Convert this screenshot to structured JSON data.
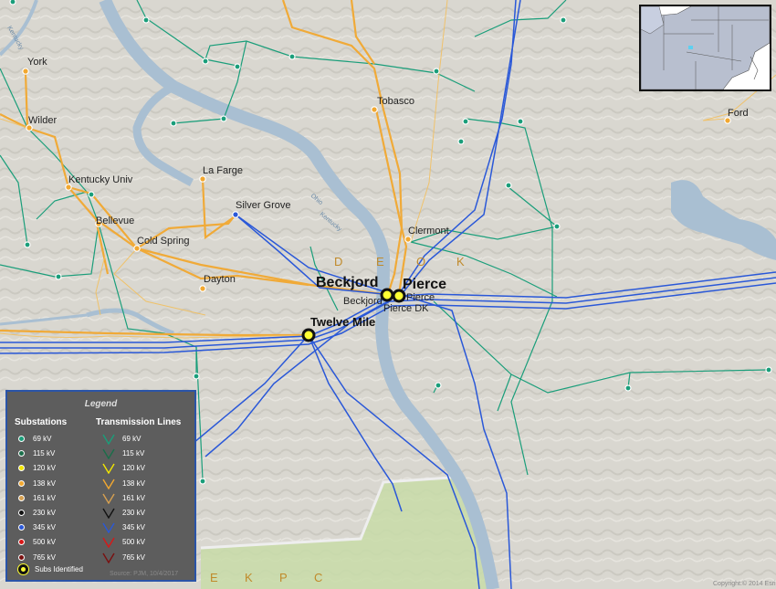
{
  "places": {
    "york": "York",
    "wilder": "Wilder",
    "tobasco": "Tobasco",
    "ford": "Ford",
    "kentucky_univ": "Kentucky Univ",
    "la_farge": "La Farge",
    "silver_grove": "Silver Grove",
    "bellevue": "Bellevue",
    "cold_spring": "Cold Spring",
    "clermont": "Clermont",
    "dayton": "Dayton",
    "beckjord_major": "Beckjord",
    "pierce_major": "Pierce",
    "beckjord_minor": "Beckjord",
    "pierce_minor": "Pierce",
    "pierce_dk": "Pierce DK",
    "twelve_mile": "Twelve Mile"
  },
  "zones": {
    "deok": [
      "D",
      "E",
      "O",
      "K"
    ],
    "ekpc": [
      "E",
      "K",
      "P",
      "C"
    ]
  },
  "rivers": {
    "ohio": "Ohio",
    "kentucky": "Kentucky",
    "licking": "Kentucky"
  },
  "legend": {
    "title": "Legend",
    "substations_heading": "Substations",
    "lines_heading": "Transmission Lines",
    "substations": [
      {
        "label": "69 kV",
        "color": "#1a9e7a"
      },
      {
        "label": "115 kV",
        "color": "#1a6e4a"
      },
      {
        "label": "120 kV",
        "color": "#f2e600"
      },
      {
        "label": "138 kV",
        "color": "#f2a830"
      },
      {
        "label": "161 kV",
        "color": "#d6a050"
      },
      {
        "label": "230 kV",
        "color": "#111111"
      },
      {
        "label": "345 kV",
        "color": "#2a58d8"
      },
      {
        "label": "500 kV",
        "color": "#d81818"
      },
      {
        "label": "765 kV",
        "color": "#7a1010"
      }
    ],
    "lines": [
      {
        "label": "69 kV",
        "color": "#1a9e7a"
      },
      {
        "label": "115 kV",
        "color": "#1a6e4a"
      },
      {
        "label": "120 kV",
        "color": "#f2e600"
      },
      {
        "label": "138 kV",
        "color": "#f2a830"
      },
      {
        "label": "161 kV",
        "color": "#d6a050"
      },
      {
        "label": "230 kV",
        "color": "#111111"
      },
      {
        "label": "345 kV",
        "color": "#2a58d8"
      },
      {
        "label": "500 kV",
        "color": "#d81818"
      },
      {
        "label": "765 kV",
        "color": "#7a1010"
      }
    ],
    "subs_identified": "Subs Identified",
    "source_note": "Source: PJM, 10/4/2017"
  },
  "copyright": "Copyright:© 2014 Esri",
  "colors": {
    "line_69": "#1a9e7a",
    "line_138": "#f2a830",
    "line_345": "#2a58d8",
    "river": "#a9bfd2",
    "terrain": "#d9d7d0",
    "green_region": "#c8dca8"
  }
}
